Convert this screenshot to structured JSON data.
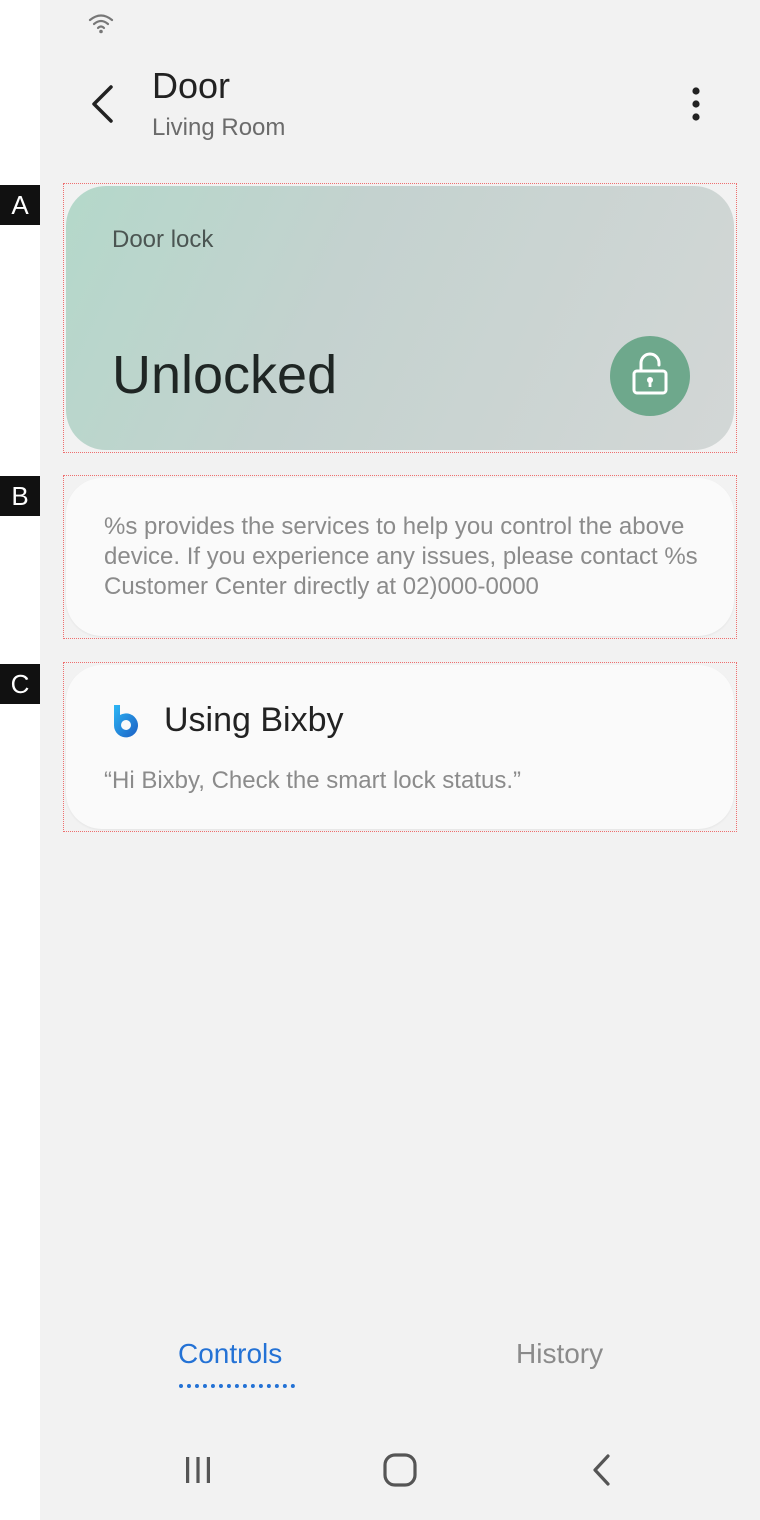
{
  "header": {
    "title": "Door",
    "subtitle": "Living Room",
    "back_icon": "chevron-left-icon",
    "more_icon": "more-vertical-icon"
  },
  "annotations": {
    "a": "A",
    "b": "B",
    "c": "C"
  },
  "lock_card": {
    "label": "Door lock",
    "status": "Unlocked",
    "icon": "unlock-icon",
    "accent": "#6ea88c"
  },
  "info_card": {
    "text": "%s provides the services to help you control the above device. If you experience any issues, please contact %s Customer Center directly at 02)000-0000"
  },
  "bixby_card": {
    "icon": "bixby-icon",
    "title": "Using Bixby",
    "hint": "“Hi Bixby, Check the smart lock status.”"
  },
  "tabs": [
    {
      "label": "Controls",
      "active": true
    },
    {
      "label": "History",
      "active": false
    }
  ],
  "colors": {
    "accent_blue": "#2472d5",
    "background": "#f2f2f2"
  },
  "system_nav": {
    "recents_icon": "recents-icon",
    "home_icon": "home-icon",
    "back_icon": "back-icon"
  },
  "status_bar": {
    "wifi_icon": "wifi-icon"
  }
}
